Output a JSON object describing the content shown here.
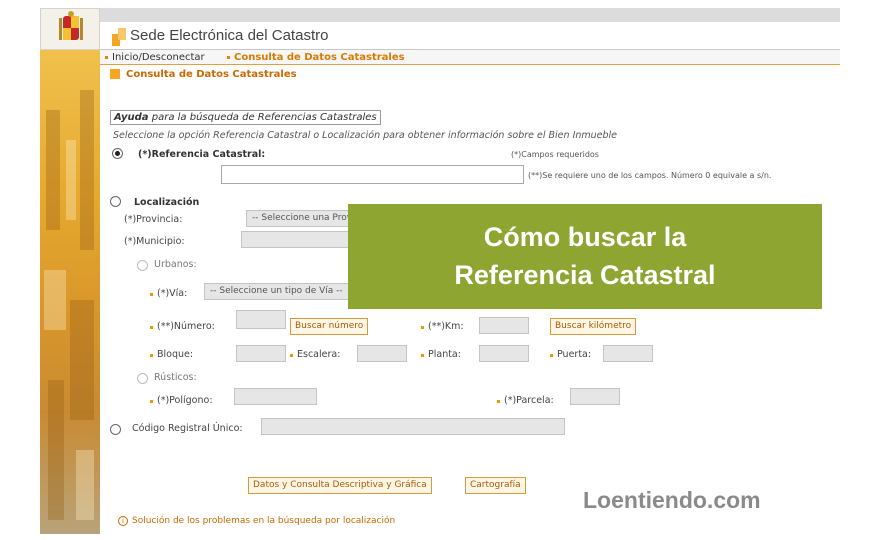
{
  "header": {
    "app_title": "Sede Electrónica del Catastro",
    "breadcrumb_home": "Inicio/Desconectar",
    "breadcrumb_current": "Consulta de Datos Catastrales"
  },
  "section": {
    "title": "Consulta de Datos Catastrales"
  },
  "help": {
    "link_bold": "Ayuda",
    "link_rest": " para la búsqueda de Referencias Catastrales",
    "instructions": "Seleccione la opción Referencia Catastral o Localización para obtener información sobre el Bien Inmueble"
  },
  "referencia": {
    "label": "(*)Referencia Catastral:",
    "required_note": "(*)Campos requeridos",
    "number_note": "(**)Se requiere uno de los campos. Número 0 equivale a s/n.",
    "value": ""
  },
  "localizacion": {
    "label": "Localización",
    "provincia_label": "(*)Provincia:",
    "provincia_value": "-- Seleccione una Provincia --",
    "municipio_label": "(*)Municipio:",
    "urbanos_label": "Urbanos:",
    "via_label": "(*)Vía:",
    "via_value": "-- Seleccione un tipo de Vía --",
    "numero_label": "(**)Número:",
    "buscar_numero": "Buscar número",
    "km_label": "(**)Km:",
    "buscar_km": "Buscar kilómetro",
    "bloque_label": "Bloque:",
    "escalera_label": "Escalera:",
    "planta_label": "Planta:",
    "puerta_label": "Puerta:",
    "rusticos_label": "Rústicos:",
    "poligono_label": "(*)Polígono:",
    "parcela_label": "(*)Parcela:"
  },
  "codigo": {
    "label": "Código Registral Único:"
  },
  "actions": {
    "datos_button": "Datos y Consulta Descriptiva y Gráfica",
    "cartografia_button": "Cartografía"
  },
  "overlay": {
    "line1": "Cómo buscar la",
    "line2": "Referencia Catastral",
    "color": "#8ea532"
  },
  "watermark": "Loentiendo.com",
  "footer_help": "Solución de los problemas en la búsqueda por localización",
  "colors": {
    "accent": "#e08a00",
    "link": "#c86a00"
  }
}
